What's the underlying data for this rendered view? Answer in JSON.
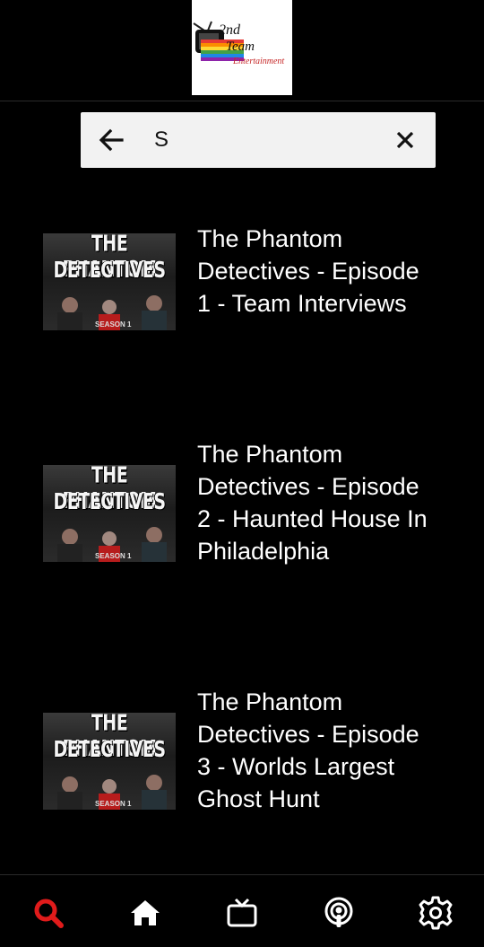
{
  "app": {
    "logo_text_1": "2nd",
    "logo_text_2": "Team",
    "logo_text_3": "Entertainment"
  },
  "search": {
    "value": "S",
    "placeholder": ""
  },
  "results": [
    {
      "title": "The Phantom Detectives - Episode 1 - Team Interviews",
      "thumb_line1": "THE PHANTOM",
      "thumb_line2": "DETECTIVES",
      "thumb_season": "SEASON 1"
    },
    {
      "title": "The Phantom Detectives - Episode 2 - Haunted House In Philadelphia",
      "thumb_line1": "THE PHANTOM",
      "thumb_line2": "DETECTIVES",
      "thumb_season": "SEASON 1"
    },
    {
      "title": "The Phantom Detectives - Episode 3 - Worlds Largest Ghost Hunt",
      "thumb_line1": "THE PHANTOM",
      "thumb_line2": "DETECTIVES",
      "thumb_season": "SEASON 1"
    }
  ],
  "nav": {
    "items": [
      "search-icon",
      "home-icon",
      "tv-icon",
      "podcast-icon",
      "gear-icon"
    ],
    "active_color": "#e01b1b",
    "inactive_color": "#ffffff"
  }
}
